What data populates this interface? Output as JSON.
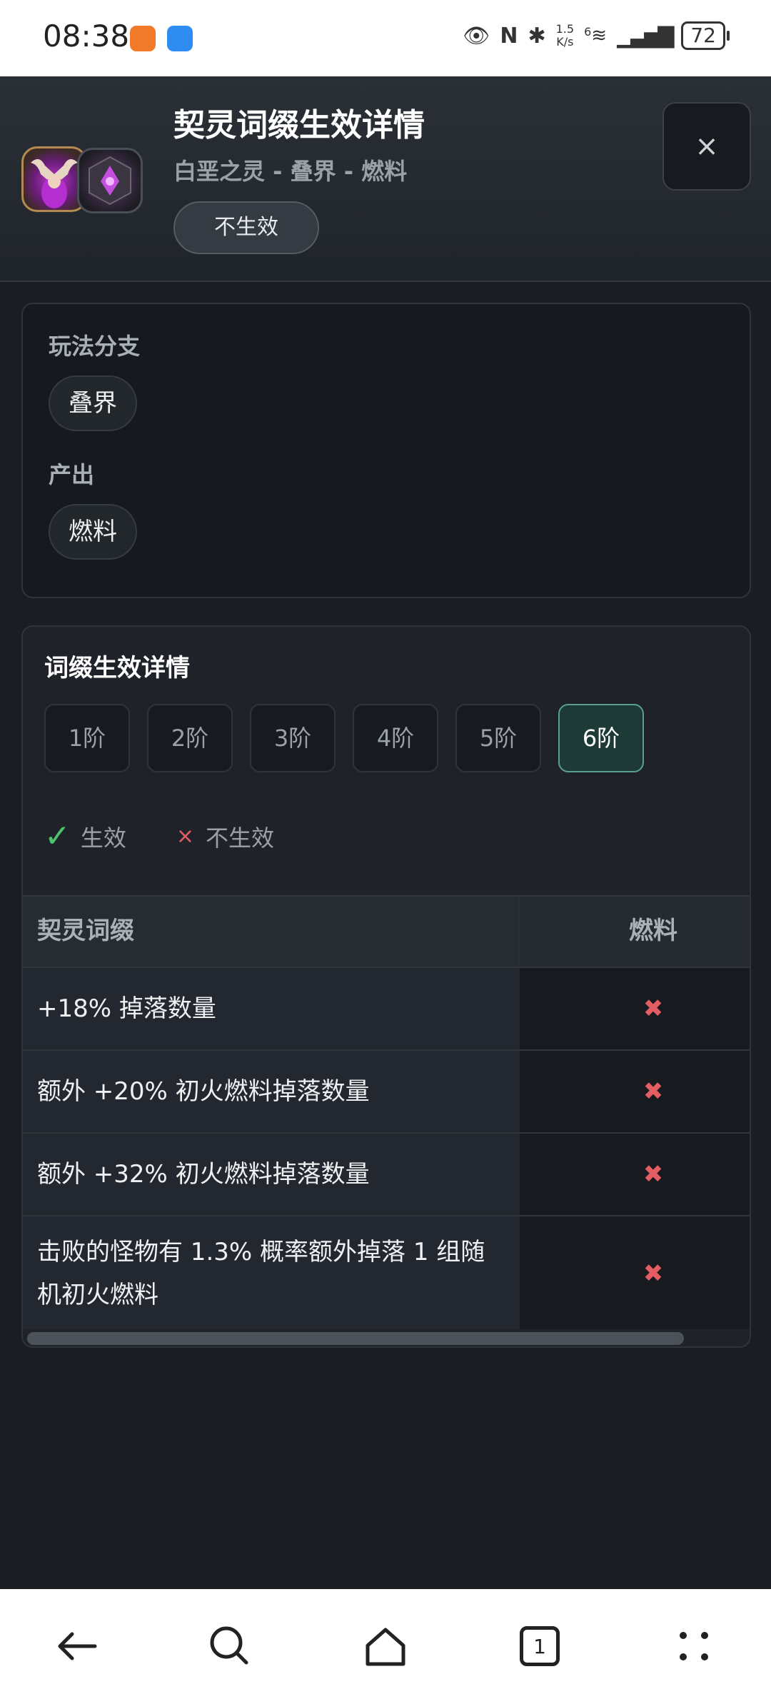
{
  "status_bar": {
    "time": "08:38",
    "speed_value": "1.5",
    "speed_unit": "K/s",
    "network": "6",
    "battery": "72"
  },
  "header": {
    "title": "契灵词缀生效详情",
    "subtitle": "白垩之灵 - 叠界 - 燃料",
    "status_badge": "不生效",
    "close_label": "×"
  },
  "info_card": {
    "branch_label": "玩法分支",
    "branch_value": "叠界",
    "output_label": "产出",
    "output_value": "燃料"
  },
  "detail_card": {
    "title": "词缀生效详情",
    "tiers": [
      "1阶",
      "2阶",
      "3阶",
      "4阶",
      "5阶",
      "6阶"
    ],
    "active_tier": "6阶",
    "legend": {
      "effective_icon": "✓",
      "effective_label": "生效",
      "ineffective_icon": "×",
      "ineffective_label": "不生效"
    },
    "table": {
      "col_affix": "契灵词缀",
      "col_fuel": "燃料",
      "rows": [
        {
          "affix": "+18% 掉落数量",
          "fuel": "✖"
        },
        {
          "affix": "额外 +20% 初火燃料掉落数量",
          "fuel": "✖"
        },
        {
          "affix": "额外 +32% 初火燃料掉落数量",
          "fuel": "✖"
        },
        {
          "affix": "击败的怪物有 1.3% 概率额外掉落 1 组随机初火燃料",
          "fuel": "✖"
        }
      ]
    }
  },
  "nav": {
    "tab_count": "1",
    "icons": [
      "back-arrow-icon",
      "search-icon",
      "home-icon",
      "tabs-icon",
      "more-icon"
    ]
  },
  "colors": {
    "background": "#1a1d22",
    "active_tier_bg": "#1e3a36",
    "effective_green": "#4cc36b",
    "ineffective_red": "#e35d62"
  }
}
